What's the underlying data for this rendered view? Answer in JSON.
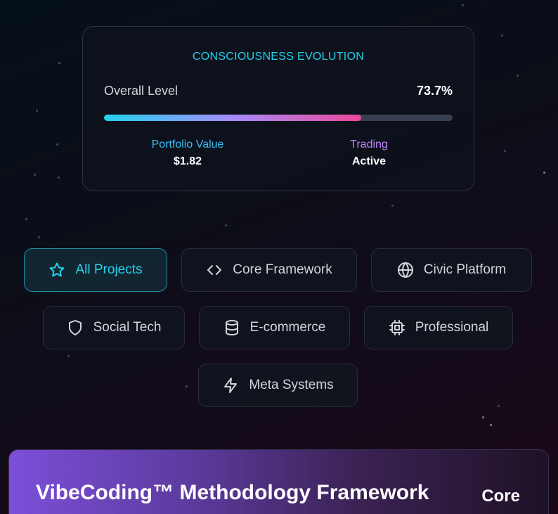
{
  "evolution": {
    "title": "CONSCIOUSNESS EVOLUTION",
    "overall_label": "Overall Level",
    "overall_value": "73.7%",
    "progress_fraction": 0.737,
    "portfolio_label": "Portfolio Value",
    "portfolio_value": "$1.82",
    "trading_label": "Trading",
    "trading_value": "Active"
  },
  "filters": [
    {
      "label": "All Projects",
      "icon": "star-icon",
      "active": true
    },
    {
      "label": "Core Framework",
      "icon": "code-icon",
      "active": false
    },
    {
      "label": "Civic Platform",
      "icon": "globe-icon",
      "active": false
    },
    {
      "label": "Social Tech",
      "icon": "shield-icon",
      "active": false
    },
    {
      "label": "E-commerce",
      "icon": "database-icon",
      "active": false
    },
    {
      "label": "Professional",
      "icon": "cpu-icon",
      "active": false
    },
    {
      "label": "Meta Systems",
      "icon": "lightning-icon",
      "active": false
    }
  ],
  "banner": {
    "title": "VibeCoding™ Methodology Framework",
    "tag": "Core"
  },
  "colors": {
    "accent": "#22d3ee",
    "purple": "#c084fc",
    "pink": "#ec4899"
  }
}
